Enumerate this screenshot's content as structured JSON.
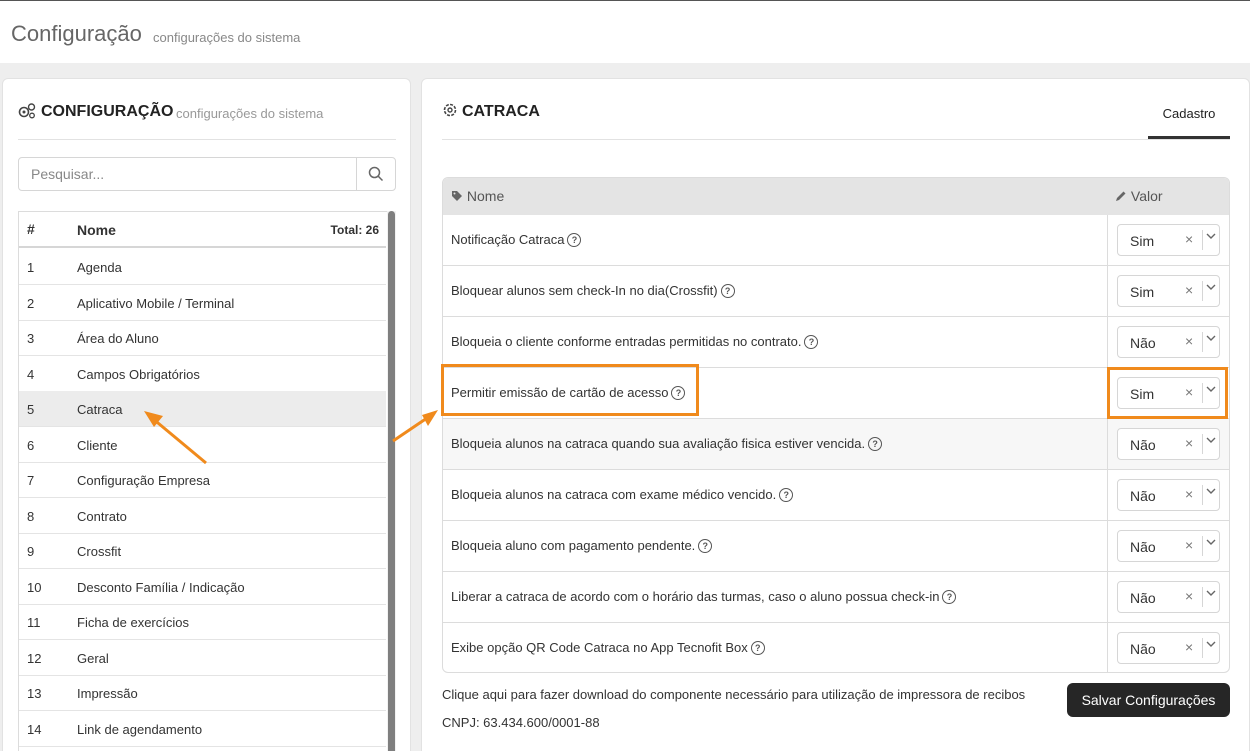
{
  "header": {
    "title": "Configuração",
    "subtitle": "configurações do sistema"
  },
  "left_panel": {
    "title": "CONFIGURAÇÃO",
    "subtitle": "configurações do sistema",
    "search_placeholder": "Pesquisar...",
    "list_header": {
      "col_num": "#",
      "col_name": "Nome",
      "total": "Total: 26"
    },
    "items": [
      {
        "num": "1",
        "name": "Agenda"
      },
      {
        "num": "2",
        "name": "Aplicativo Mobile / Terminal"
      },
      {
        "num": "3",
        "name": "Área do Aluno"
      },
      {
        "num": "4",
        "name": "Campos Obrigatórios"
      },
      {
        "num": "5",
        "name": "Catraca"
      },
      {
        "num": "6",
        "name": "Cliente"
      },
      {
        "num": "7",
        "name": "Configuração Empresa"
      },
      {
        "num": "8",
        "name": "Contrato"
      },
      {
        "num": "9",
        "name": "Crossfit"
      },
      {
        "num": "10",
        "name": "Desconto Família / Indicação"
      },
      {
        "num": "11",
        "name": "Ficha de exercícios"
      },
      {
        "num": "12",
        "name": "Geral"
      },
      {
        "num": "13",
        "name": "Impressão"
      },
      {
        "num": "14",
        "name": "Link de agendamento"
      }
    ],
    "active_item": "Catraca"
  },
  "right_panel": {
    "title": "CATRACA",
    "tab": "Cadastro",
    "table_header": {
      "name": "Nome",
      "value": "Valor"
    },
    "rows": [
      {
        "label": "Notificação Catraca",
        "value": "Sim"
      },
      {
        "label": "Bloquear alunos sem check-In no dia(Crossfit)",
        "value": "Sim"
      },
      {
        "label": "Bloqueia o cliente conforme entradas permitidas no contrato.",
        "value": "Não"
      },
      {
        "label": "Permitir emissão de cartão de acesso",
        "value": "Sim"
      },
      {
        "label": "Bloqueia alunos na catraca quando sua avaliação fisica estiver vencida.",
        "value": "Não"
      },
      {
        "label": "Bloqueia alunos na catraca com exame médico vencido.",
        "value": "Não"
      },
      {
        "label": "Bloqueia aluno com pagamento pendente.",
        "value": "Não"
      },
      {
        "label": "Liberar a catraca de acordo com o horário das turmas, caso o aluno possua check-in",
        "value": "Não"
      },
      {
        "label": "Exibe opção QR Code Catraca no App Tecnofit Box",
        "value": "Não"
      }
    ],
    "download_link": "Clique aqui para fazer download do componente necessário para utilização de impressora de recibos",
    "cnpj": "CNPJ: 63.434.600/0001-88",
    "save_button": "Salvar Configurações"
  },
  "colors": {
    "highlight": "#f08a1c",
    "button": "#262626"
  },
  "icons": [
    "gears-icon",
    "gear-icon",
    "search-icon",
    "tag-icon",
    "pencil-icon",
    "help-icon",
    "clear-icon",
    "chevron-down-icon",
    "arrow-icon"
  ]
}
